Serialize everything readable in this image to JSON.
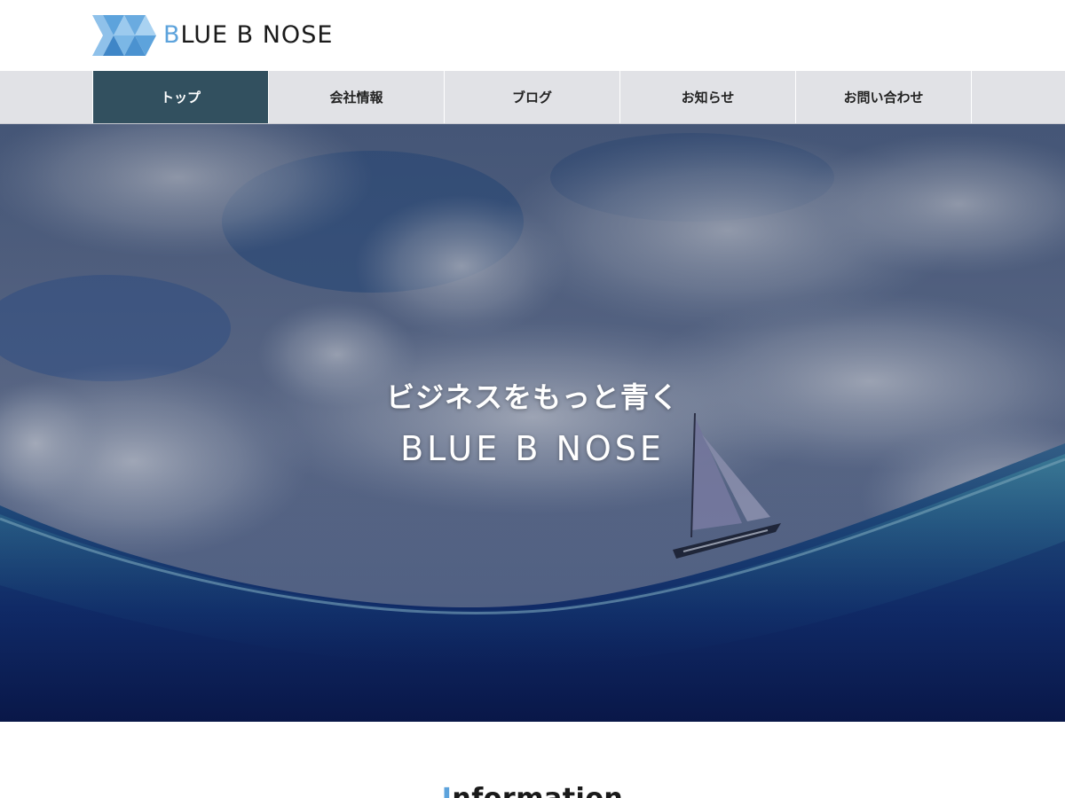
{
  "header": {
    "logo": {
      "text_first": "B",
      "text_rest": "LUE B NOSE"
    }
  },
  "nav": {
    "items": [
      {
        "label": "トップ",
        "active": true
      },
      {
        "label": "会社情報",
        "active": false
      },
      {
        "label": "ブログ",
        "active": false
      },
      {
        "label": "お知らせ",
        "active": false
      },
      {
        "label": "お問い合わせ",
        "active": false
      }
    ]
  },
  "hero": {
    "tagline": "ビジネスをもっと青く",
    "brand": "BLUE B NOSE",
    "image": "sailboat-sea-sky"
  },
  "info": {
    "title_first": "I",
    "title_rest": "nformation"
  },
  "colors": {
    "accent": "#5da3dc",
    "nav_active_bg": "#32505f",
    "nav_bg": "#e1e2e6",
    "hero_sea": "#0b1a5a"
  }
}
